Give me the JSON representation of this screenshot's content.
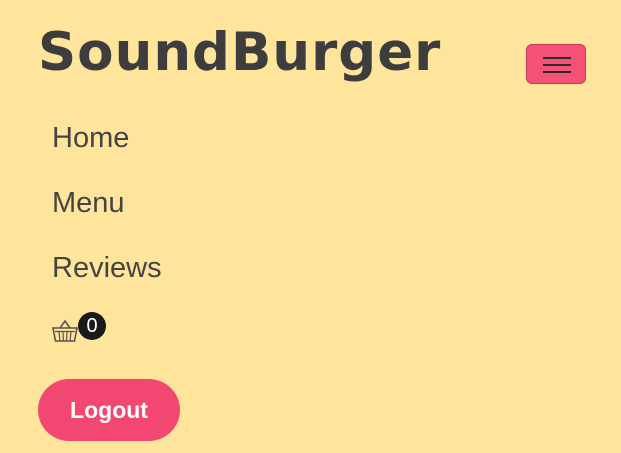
{
  "navbar": {
    "brand": "SoundBurger",
    "toggler_icon": "hamburger-icon",
    "toggler_color": "#f55278"
  },
  "nav": {
    "items": [
      {
        "label": "Home"
      },
      {
        "label": "Menu"
      },
      {
        "label": "Reviews"
      }
    ]
  },
  "cart": {
    "icon": "basket-icon",
    "count": "0"
  },
  "logout": {
    "label": "Logout",
    "color": "#f24771"
  },
  "colors": {
    "background": "#ffe49b",
    "text": "#444444"
  }
}
